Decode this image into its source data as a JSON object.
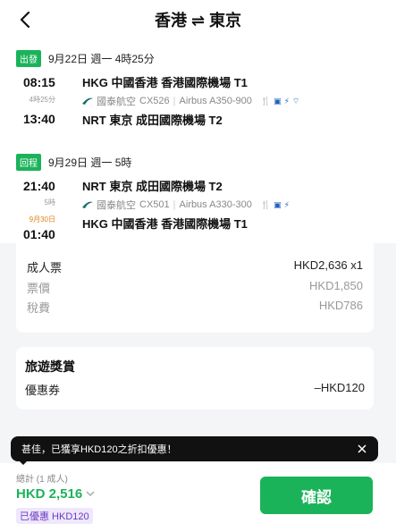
{
  "header": {
    "title": "香港 ⇌ 東京"
  },
  "outbound": {
    "badge": "出發",
    "date": "9月22日 週一 4時25分",
    "dep_time": "08:15",
    "duration": "4時25分",
    "arr_time": "13:40",
    "dep_airport": "HKG 中國香港 香港國際機場 T1",
    "airline": "國泰航空",
    "flight_no": "CX526",
    "aircraft": "Airbus A350-900",
    "arr_airport": "NRT 東京 成田國際機場 T2"
  },
  "inbound": {
    "badge": "回程",
    "date": "9月29日 週一 5時",
    "dep_time": "21:40",
    "duration": "5時",
    "next_day": "9月30日",
    "arr_time": "01:40",
    "dep_airport": "NRT 東京 成田國際機場 T2",
    "airline": "國泰航空",
    "flight_no": "CX501",
    "aircraft": "Airbus A330-300",
    "arr_airport": "HKG 中國香港 香港國際機場 T1"
  },
  "price": {
    "adult_label": "成人票",
    "adult_value": "HKD2,636 x1",
    "fare_label": "票價",
    "fare_value": "HKD1,850",
    "tax_label": "稅費",
    "tax_value": "HKD786"
  },
  "reward": {
    "title": "旅遊獎賞",
    "coupon_label": "優惠券",
    "coupon_value": "–HKD120"
  },
  "toast": {
    "text": "甚佳，已獲享HKD120之折扣優惠！"
  },
  "footer": {
    "total_label": "總計 (1 成人)",
    "total_price": "HKD 2,516",
    "discount_tag": "已優惠 HKD120",
    "confirm_label": "確認"
  },
  "colors": {
    "accent": "#1bb35a",
    "next_day": "#e0861a",
    "discount_tag": "#6a3cc0"
  }
}
